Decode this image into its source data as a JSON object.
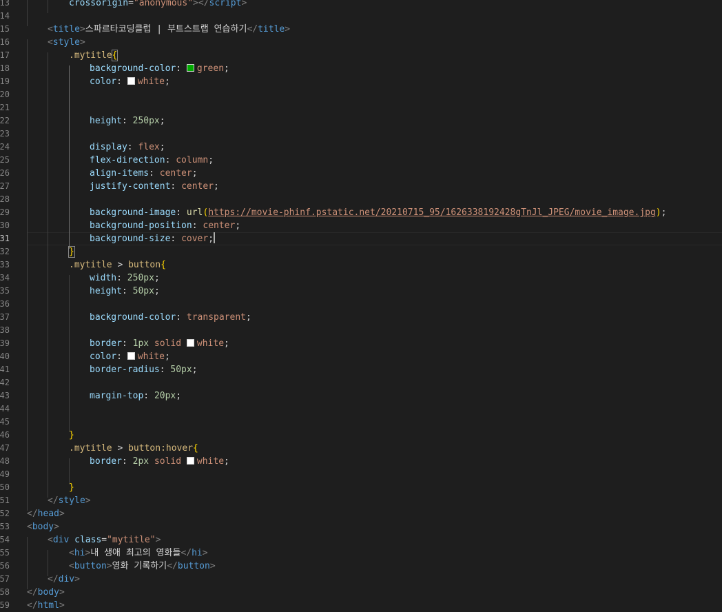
{
  "colors": {
    "green_swatch": "#00aa00",
    "white_swatch": "#ffffff"
  },
  "gutter": [
    "13",
    "14",
    "15",
    "16",
    "17",
    "18",
    "19",
    "20",
    "21",
    "22",
    "23",
    "24",
    "25",
    "26",
    "27",
    "28",
    "29",
    "30",
    "31",
    "32",
    "33",
    "34",
    "35",
    "36",
    "37",
    "38",
    "39",
    "40",
    "41",
    "42",
    "43",
    "44",
    "45",
    "46",
    "47",
    "48",
    "49",
    "50",
    "51",
    "52",
    "53",
    "54",
    "55",
    "56",
    "57",
    "58",
    "59"
  ],
  "code": {
    "l13": {
      "attr": "crossorigin",
      "eq": "=",
      "val": "\"anonymous\"",
      "close_open": "></",
      "tag": "script",
      "close": ">"
    },
    "l15": {
      "open": "<",
      "tag": "title",
      "gt": ">",
      "text": "스파르타코딩클럽 | 부트스트랩 연습하기",
      "close_open": "</",
      "tag2": "title",
      "close": ">"
    },
    "l16": {
      "open": "<",
      "tag": "style",
      "close": ">"
    },
    "l17": {
      "selector": ".mytitle",
      "brace": "{"
    },
    "l18": {
      "prop": "background-color",
      "colon": ": ",
      "val": "green",
      "semi": ";"
    },
    "l19": {
      "prop": "color",
      "colon": ": ",
      "val": "white",
      "semi": ";"
    },
    "l22": {
      "prop": "height",
      "colon": ": ",
      "val": "250px",
      "semi": ";"
    },
    "l24": {
      "prop": "display",
      "colon": ": ",
      "val": "flex",
      "semi": ";"
    },
    "l25": {
      "prop": "flex-direction",
      "colon": ": ",
      "val": "column",
      "semi": ";"
    },
    "l26": {
      "prop": "align-items",
      "colon": ": ",
      "val": "center",
      "semi": ";"
    },
    "l27": {
      "prop": "justify-content",
      "colon": ": ",
      "val": "center",
      "semi": ";"
    },
    "l29": {
      "prop": "background-image",
      "colon": ": ",
      "fn": "url",
      "paren_open": "(",
      "url": "https://movie-phinf.pstatic.net/20210715_95/1626338192428gTnJl_JPEG/movie_image.jpg",
      "paren_close": ")",
      "semi": ";"
    },
    "l30": {
      "prop": "background-position",
      "colon": ": ",
      "val": "center",
      "semi": ";"
    },
    "l31": {
      "prop": "background-size",
      "colon": ": ",
      "val": "cover",
      "semi": ";"
    },
    "l32": {
      "brace": "}"
    },
    "l33": {
      "selector": ".mytitle",
      "combinator": " > ",
      "selector2": "button",
      "brace": "{"
    },
    "l34": {
      "prop": "width",
      "colon": ": ",
      "val": "250px",
      "semi": ";"
    },
    "l35": {
      "prop": "height",
      "colon": ": ",
      "val": "50px",
      "semi": ";"
    },
    "l37": {
      "prop": "background-color",
      "colon": ": ",
      "val": "transparent",
      "semi": ";"
    },
    "l39": {
      "prop": "border",
      "colon": ": ",
      "num": "1px",
      "kw": " solid ",
      "val": "white",
      "semi": ";"
    },
    "l40": {
      "prop": "color",
      "colon": ": ",
      "val": "white",
      "semi": ";"
    },
    "l41": {
      "prop": "border-radius",
      "colon": ": ",
      "val": "50px",
      "semi": ";"
    },
    "l43": {
      "prop": "margin-top",
      "colon": ": ",
      "val": "20px",
      "semi": ";"
    },
    "l46": {
      "brace": "}"
    },
    "l47": {
      "selector": ".mytitle",
      "combinator": " > ",
      "selector2": "button:hover",
      "brace": "{"
    },
    "l48": {
      "prop": "border",
      "colon": ": ",
      "num": "2px",
      "kw": " solid ",
      "val": "white",
      "semi": ";"
    },
    "l50": {
      "brace": "}"
    },
    "l51": {
      "open": "</",
      "tag": "style",
      "close": ">"
    },
    "l52": {
      "open": "</",
      "tag": "head",
      "close": ">"
    },
    "l53": {
      "open": "<",
      "tag": "body",
      "close": ">"
    },
    "l54": {
      "open": "<",
      "tag": "div",
      "attr": " class",
      "eq": "=",
      "val": "\"mytitle\"",
      "close": ">"
    },
    "l55": {
      "open": "<",
      "tag": "hi",
      "gt": ">",
      "text": "내 생애 최고의 영화들",
      "close_open": "</",
      "tag2": "hi",
      "close": ">"
    },
    "l56": {
      "open": "<",
      "tag": "button",
      "gt": ">",
      "text": "영화 기록하기",
      "close_open": "</",
      "tag2": "button",
      "close": ">"
    },
    "l57": {
      "open": "</",
      "tag": "div",
      "close": ">"
    },
    "l58": {
      "open": "</",
      "tag": "body",
      "close": ">"
    },
    "l59": {
      "open": "</",
      "tag": "html",
      "close": ">"
    }
  }
}
